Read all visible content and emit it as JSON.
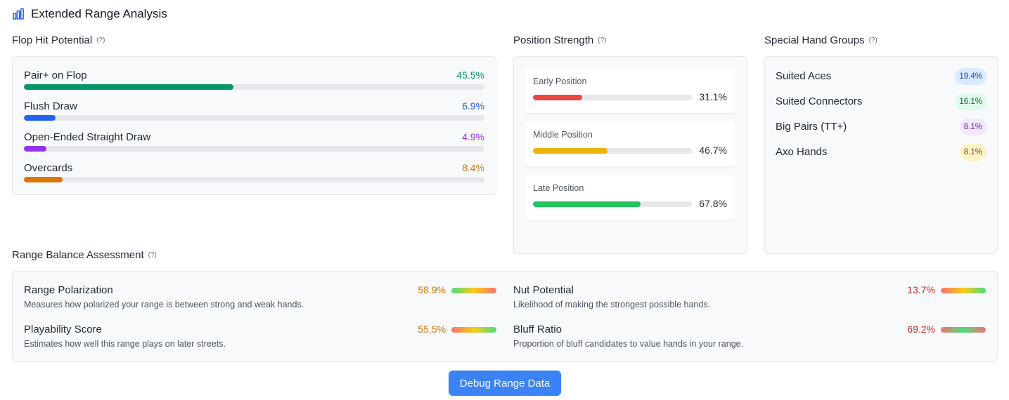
{
  "header": {
    "title": "Extended Range Analysis",
    "icon": "bar-chart-icon"
  },
  "flop": {
    "title": "Flop Hit Potential",
    "help": "(?)",
    "items": [
      {
        "label": "Pair+ on Flop",
        "value": "45.5%",
        "fraction": 0.455,
        "color": "#059669"
      },
      {
        "label": "Flush Draw",
        "value": "6.9%",
        "fraction": 0.069,
        "color": "#2563eb"
      },
      {
        "label": "Open-Ended Straight Draw",
        "value": "4.9%",
        "fraction": 0.049,
        "color": "#9333ea"
      },
      {
        "label": "Overcards",
        "value": "8.4%",
        "fraction": 0.084,
        "color": "#d97706"
      }
    ]
  },
  "position": {
    "title": "Position Strength",
    "help": "(?)",
    "items": [
      {
        "label": "Early Position",
        "value": "31.1%",
        "fraction": 0.311,
        "color": "#ef4444"
      },
      {
        "label": "Middle Position",
        "value": "46.7%",
        "fraction": 0.467,
        "color": "#eab308"
      },
      {
        "label": "Late Position",
        "value": "67.8%",
        "fraction": 0.678,
        "color": "#22c55e"
      }
    ]
  },
  "special": {
    "title": "Special Hand Groups",
    "help": "(?)",
    "items": [
      {
        "label": "Suited Aces",
        "value": "19.4%",
        "bg": "#dbeafe",
        "fg": "#1e40af"
      },
      {
        "label": "Suited Connectors",
        "value": "16.1%",
        "bg": "#dcfce7",
        "fg": "#166534"
      },
      {
        "label": "Big Pairs (TT+)",
        "value": "8.1%",
        "bg": "#f3e8ff",
        "fg": "#6b21a8"
      },
      {
        "label": "Axo Hands",
        "value": "8.1%",
        "bg": "#fef3c7",
        "fg": "#92400e"
      }
    ]
  },
  "balance": {
    "title": "Range Balance Assessment",
    "help": "(?)",
    "items": [
      {
        "label": "Range Polarization",
        "desc": "Measures how polarized your range is between strong and weak hands.",
        "value": "58.9%",
        "valueColor": "#d97706",
        "gradient": "linear-gradient(to right, #4ade80, #facc15, #f87171)"
      },
      {
        "label": "Nut Potential",
        "desc": "Likelihood of making the strongest possible hands.",
        "value": "13.7%",
        "valueColor": "#dc2626",
        "gradient": "linear-gradient(to right, #f87171, #facc15, #4ade80)"
      },
      {
        "label": "Playability Score",
        "desc": "Estimates how well this range plays on later streets.",
        "value": "55.5%",
        "valueColor": "#d97706",
        "gradient": "linear-gradient(to right, #f87171, #facc15, #4ade80)"
      },
      {
        "label": "Bluff Ratio",
        "desc": "Proportion of bluff candidates to value hands in your range.",
        "value": "69.2%",
        "valueColor": "#dc2626",
        "gradient": "linear-gradient(to right, #f87171, #4ade80, #f87171)"
      }
    ]
  },
  "debug_button": {
    "label": "Debug Range Data"
  }
}
